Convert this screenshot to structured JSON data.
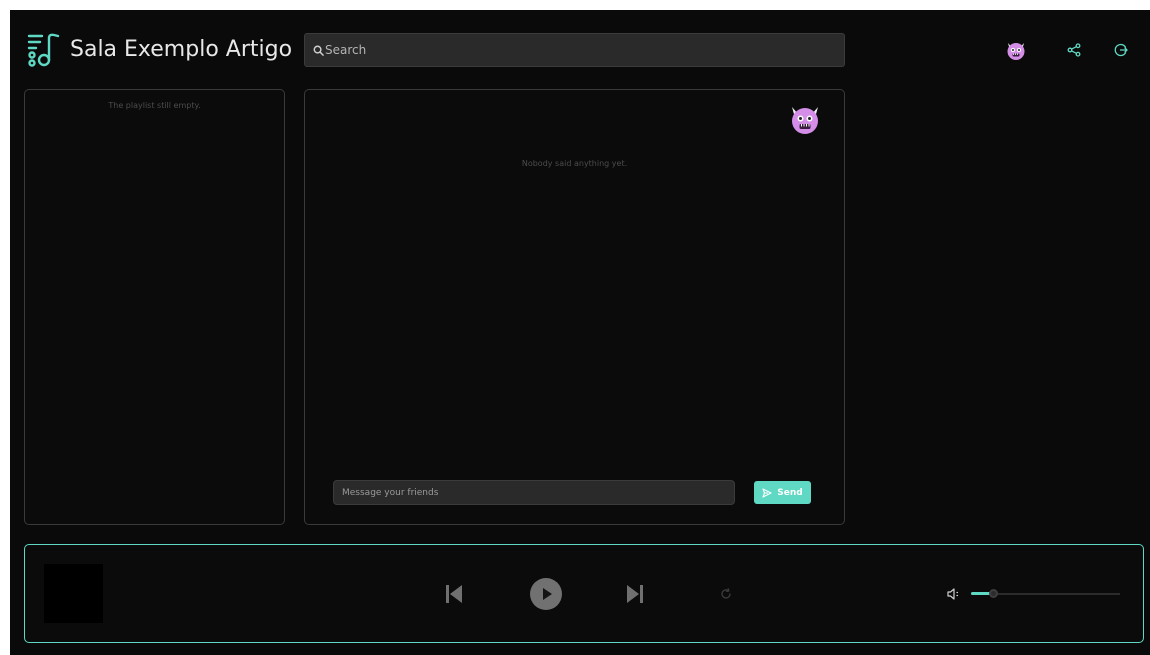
{
  "header": {
    "room_title": "Sala Exemplo Artigo",
    "search_placeholder": "Search",
    "icons": [
      "music-note-list-icon",
      "user-avatar-icon",
      "share-icon",
      "logout-icon"
    ]
  },
  "playlist": {
    "empty_text": "The playlist still empty."
  },
  "chat": {
    "empty_text": "Nobody said anything yet.",
    "message_placeholder": "Message your friends",
    "send_label": "Send"
  },
  "player": {
    "controls": [
      "previous-icon",
      "play-icon",
      "next-icon",
      "repeat-icon",
      "volume-icon"
    ],
    "volume_level": 0.15
  },
  "colors": {
    "accent": "#5fd9c4",
    "background": "#0a0a0a",
    "panel_border": "#3a3a3a",
    "avatar": "#d58ee8"
  }
}
